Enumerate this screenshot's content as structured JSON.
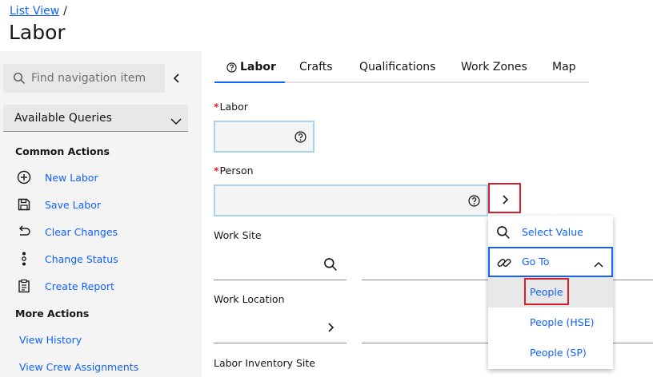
{
  "header": {
    "breadcrumb_link": "List View",
    "breadcrumb_sep": "/",
    "title": "Labor"
  },
  "sidebar": {
    "search_placeholder": "Find navigation item",
    "queries_label": "Available Queries",
    "common_actions_title": "Common Actions",
    "common_actions": [
      {
        "label": "New Labor",
        "icon": "add-circle-icon"
      },
      {
        "label": "Save Labor",
        "icon": "save-icon"
      },
      {
        "label": "Clear Changes",
        "icon": "undo-icon"
      },
      {
        "label": "Change Status",
        "icon": "status-icon"
      },
      {
        "label": "Create Report",
        "icon": "report-icon"
      }
    ],
    "more_actions_title": "More Actions",
    "more_actions": [
      "View History",
      "View Crew Assignments"
    ]
  },
  "tabs": [
    {
      "label": "Labor",
      "active": true
    },
    {
      "label": "Crafts"
    },
    {
      "label": "Qualifications"
    },
    {
      "label": "Work Zones"
    },
    {
      "label": "Map"
    }
  ],
  "form": {
    "labor_label": "Labor",
    "labor_value": "",
    "person_label": "Person",
    "person_value": "",
    "required_mark": "*",
    "work_site_label": "Work Site",
    "work_site_value": "",
    "work_location_label": "Work Location",
    "work_location_value": "",
    "labor_inventory_site_label": "Labor Inventory Site"
  },
  "menu": {
    "select_value": "Select Value",
    "go_to": "Go To",
    "people": "People",
    "people_hse": "People (HSE)",
    "people_sp": "People (SP)"
  },
  "colors": {
    "link": "#0f62fe",
    "required": "#da1e28",
    "highlight_box": "#da1e28",
    "input_border": "#a6d3f0"
  }
}
